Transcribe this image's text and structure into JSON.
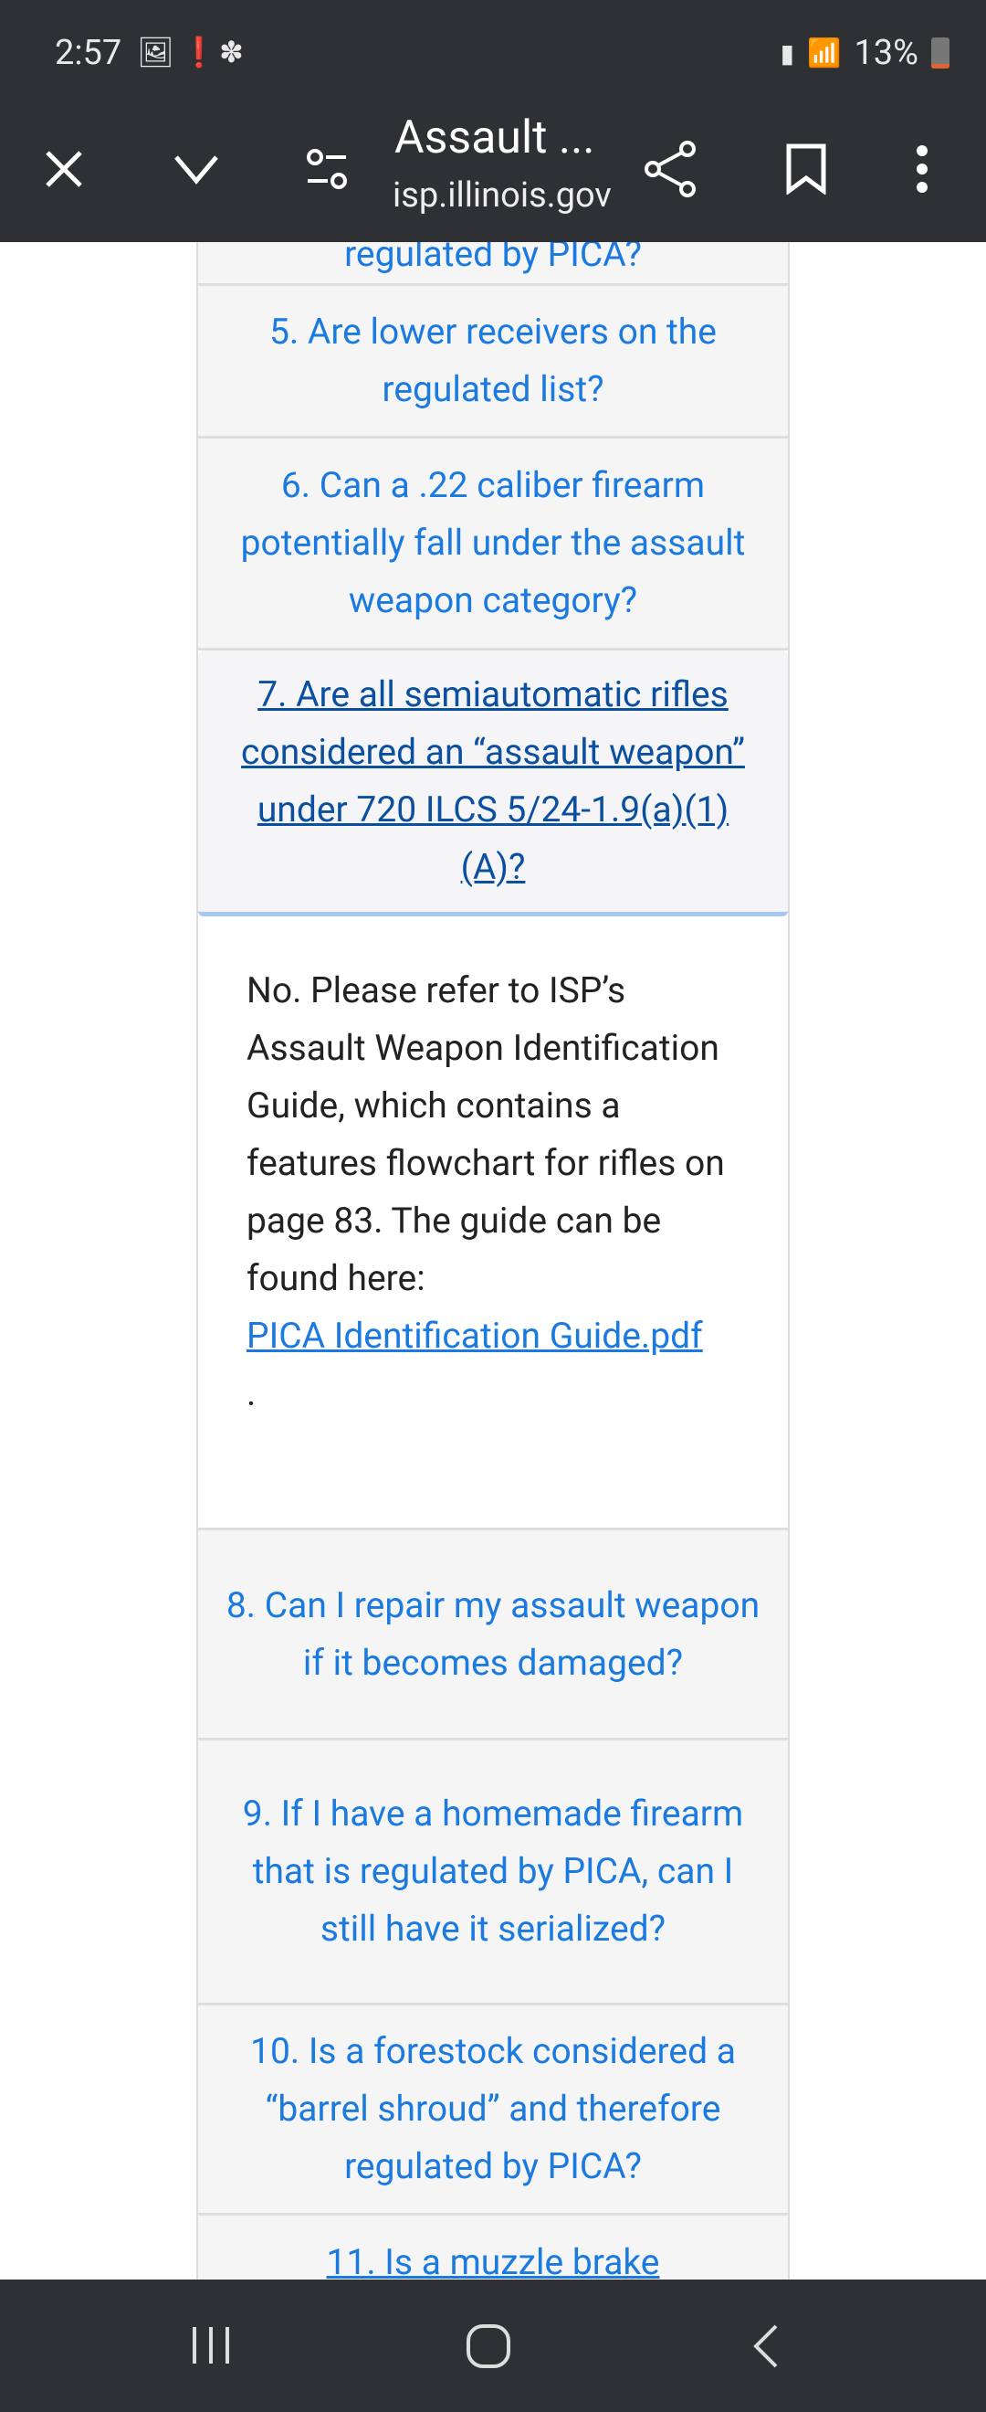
{
  "status_bar": {
    "time": "2:57",
    "battery": "13%"
  },
  "toolbar": {
    "title": "Assault ...",
    "url": "isp.illinois.gov"
  },
  "faq": {
    "partial_top": "regulated by PICA?",
    "q5": "5. Are lower receivers on the regulated list?",
    "q6": "6. Can a .22 caliber firearm potentially fall under the assault weapon category?",
    "q7": "7. Are all semiautomatic rifles considered an “assault weapon” under 720 ILCS 5/24-1.9(a)(1)(A)?",
    "a7_text": "No. Please refer to ISP’s Assault Weapon Identification Guide, which contains a features flowchart for rifles on page 83. The guide can be found here:",
    "a7_link": "PICA Identification Guide.pdf",
    "a7_end": ".",
    "q8": "8. Can I repair my assault weapon if it becomes damaged?",
    "q9": "9. If I have a homemade firearm that is regulated by PICA, can I still have it serialized?",
    "q10": "10. Is a forestock considered a “barrel shroud” and therefore regulated by PICA?",
    "q11": "11. Is a muzzle brake"
  },
  "colors": {
    "link": "#1a7ae0",
    "active": "#0b4fa0",
    "chrome": "#2f3033"
  }
}
